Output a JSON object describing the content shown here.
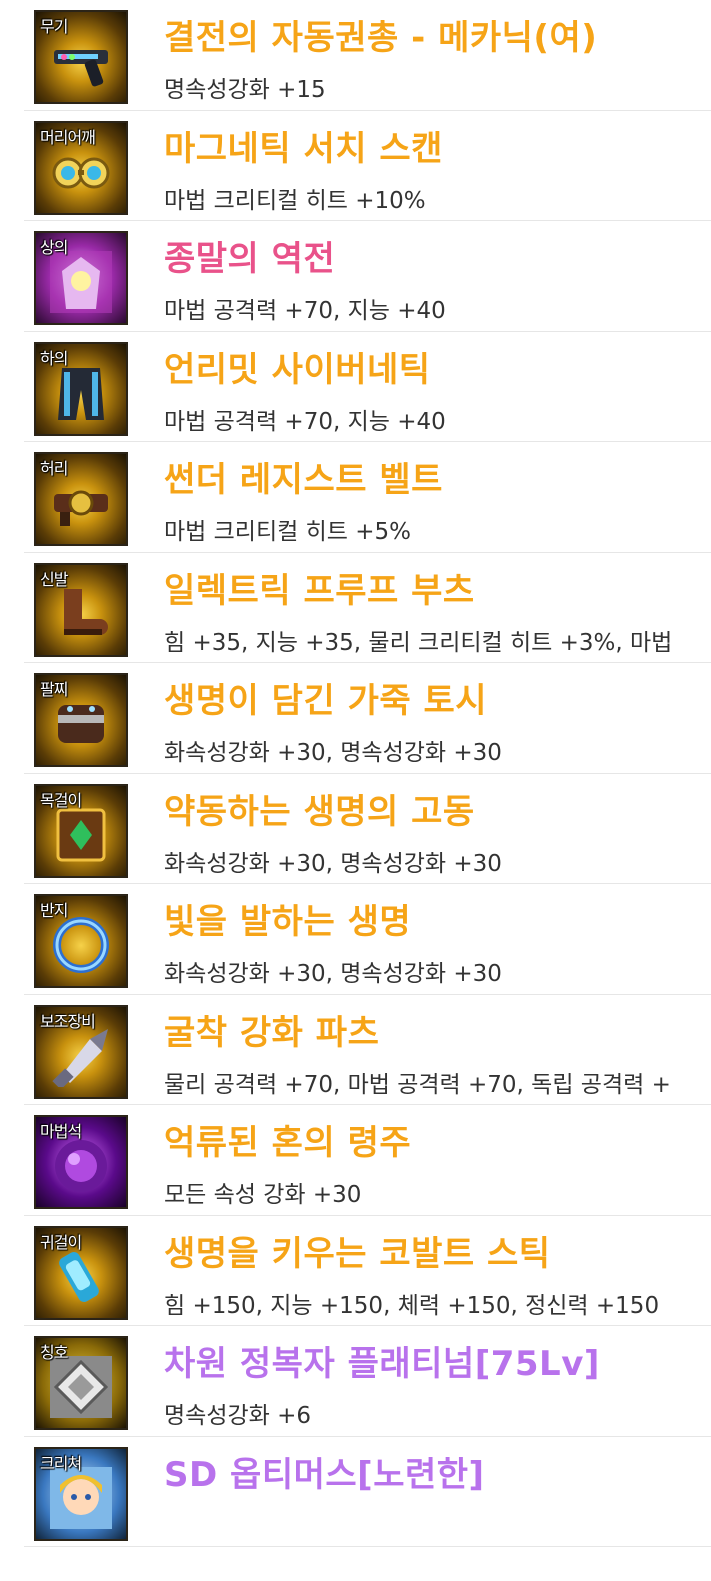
{
  "colors": {
    "epic": "#f6a417",
    "legendary": "#e9528a",
    "rare": "#b872ec",
    "stat_text": "#333333",
    "divider": "#e6e6e6"
  },
  "items": [
    {
      "slot": "무기",
      "name": "결전의 자동권총 - 메카닉(여)",
      "stats": "명속성강화 +15",
      "grade": "epic",
      "icon": "revolver-icon"
    },
    {
      "slot": "머리어깨",
      "name": "마그네틱 서치 스캔",
      "stats": "마법 크리티컬 히트 +10%",
      "grade": "epic",
      "icon": "goggles-icon"
    },
    {
      "slot": "상의",
      "name": "종말의 역전",
      "stats": "마법 공격력 +70, 지능 +40",
      "grade": "legendary",
      "icon": "robe-icon"
    },
    {
      "slot": "하의",
      "name": "언리밋 사이버네틱",
      "stats": "마법 공격력 +70, 지능 +40",
      "grade": "epic",
      "icon": "pants-icon"
    },
    {
      "slot": "허리",
      "name": "썬더 레지스트 벨트",
      "stats": "마법 크리티컬 히트 +5%",
      "grade": "epic",
      "icon": "belt-icon"
    },
    {
      "slot": "신발",
      "name": "일렉트릭 프루프 부츠",
      "stats": "힘 +35, 지능 +35, 물리 크리티컬 히트 +3%, 마법",
      "grade": "epic",
      "icon": "boots-icon"
    },
    {
      "slot": "팔찌",
      "name": "생명이 담긴 가죽 토시",
      "stats": "화속성강화 +30, 명속성강화 +30",
      "grade": "epic",
      "icon": "bracer-icon"
    },
    {
      "slot": "목걸이",
      "name": "약동하는 생명의 고동",
      "stats": "화속성강화 +30, 명속성강화 +30",
      "grade": "epic",
      "icon": "necklace-icon"
    },
    {
      "slot": "반지",
      "name": "빛을 발하는 생명",
      "stats": "화속성강화 +30, 명속성강화 +30",
      "grade": "epic",
      "icon": "ring-icon"
    },
    {
      "slot": "보조장비",
      "name": "굴착 강화 파츠",
      "stats": "물리 공격력 +70, 마법 공격력 +70, 독립 공격력 +",
      "grade": "epic",
      "icon": "drill-icon"
    },
    {
      "slot": "마법석",
      "name": "억류된 혼의 령주",
      "stats": "모든 속성 강화 +30",
      "grade": "epic",
      "icon": "magic-stone-icon"
    },
    {
      "slot": "귀걸이",
      "name": "생명을 키우는 코발트 스틱",
      "stats": "힘 +150, 지능 +150, 체력 +150, 정신력 +150",
      "grade": "epic",
      "icon": "earring-icon"
    },
    {
      "slot": "칭호",
      "name": "차원 정복자 플래티넘[75Lv]",
      "stats": "명속성강화 +6",
      "grade": "rare",
      "icon": "title-icon"
    },
    {
      "slot": "크리쳐",
      "name": "SD 옵티머스[노련한]",
      "stats": "",
      "grade": "rare",
      "icon": "creature-icon"
    }
  ]
}
